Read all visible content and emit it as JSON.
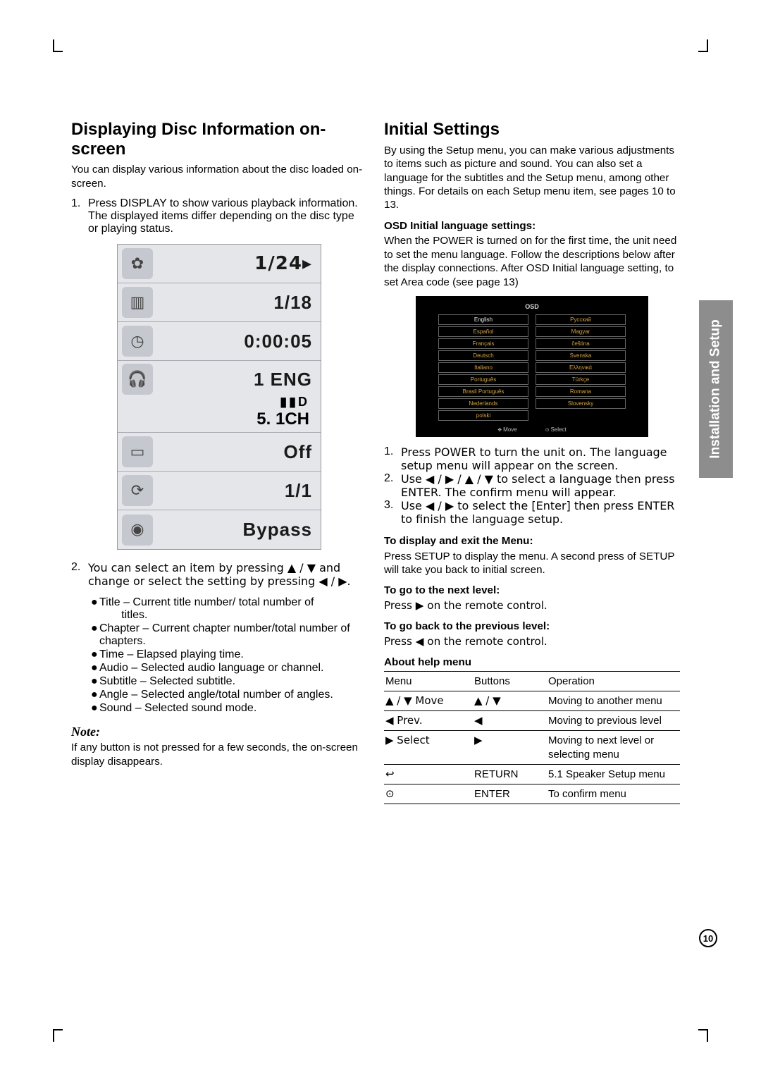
{
  "page_number": "10",
  "side_tab": "Installation and Setup",
  "left": {
    "h": "Displaying Disc Information on-screen",
    "intro": "You can display various information about the disc loaded on-screen.",
    "step1_a": "Press DISPLAY to show various playback information.",
    "step1_b": "The displayed items differ depending on the disc type or playing status.",
    "osd": {
      "title": "1/24",
      "chapter": "1/18",
      "time": "0:00:05",
      "audio_line1": "1 ENG",
      "audio_line2": "D",
      "audio_line3": "5. 1CH",
      "subtitle": "Off",
      "angle": "1/1",
      "sound": "Bypass"
    },
    "step2": "You can select an item by pressing ▲ / ▼ and change or select the setting by pressing ◀ / ▶.",
    "bullets": {
      "b1a": "Title – Current title number/ total number of",
      "b1b": "titles.",
      "b2": "Chapter – Current chapter number/total number of chapters.",
      "b3": "Time – Elapsed playing time.",
      "b4": "Audio – Selected audio language or channel.",
      "b5": "Subtitle – Selected subtitle.",
      "b6": "Angle – Selected angle/total number of angles.",
      "b7": "Sound – Selected sound mode."
    },
    "note_h": "Note:",
    "note_p": "If any button is not pressed for a few seconds, the on-screen display disappears."
  },
  "right": {
    "h": "Initial Settings",
    "intro": "By using the Setup menu, you can make various adjustments to items such as picture and sound. You can also set a language for the subtitles and the Setup menu, among other things. For details on each Setup menu item, see pages 10 to 13.",
    "sub1": "OSD Initial language settings:",
    "sub1_p": "When the POWER is turned on for the first time, the unit need to set the menu language. Follow the descriptions below after the display connections. After OSD Initial language setting, to set Area code (see page 13)",
    "lang_menu": {
      "title": "OSD",
      "left_col": [
        "English",
        "Español",
        "Français",
        "Deutsch",
        "Italiano",
        "Português",
        "Brasil Português",
        "Nederlands",
        "polski"
      ],
      "right_col": [
        "Русский",
        "Magyar",
        "čeština",
        "Svenska",
        "Ελληνικά",
        "Türkçe",
        "Romana",
        "Slovensky"
      ],
      "foot_move": "Move",
      "foot_select": "Select"
    },
    "steps": {
      "s1": "Press POWER to turn the unit on. The language setup menu will appear on the screen.",
      "s2": "Use ◀ / ▶ / ▲ / ▼ to select a language then press ENTER. The confirm menu will appear.",
      "s3": "Use ◀ / ▶ to select the [Enter] then press ENTER to finish the language setup."
    },
    "sub2": "To display and exit the Menu:",
    "sub2_p": "Press SETUP to display the menu. A second press of SETUP will take you back to initial screen.",
    "sub3": "To go to the next level:",
    "sub3_p": "Press ▶ on the remote control.",
    "sub4": "To go back to the previous level:",
    "sub4_p": "Press ◀ on the remote control.",
    "sub5": "About help menu",
    "table": {
      "h1": "Menu",
      "h2": "Buttons",
      "h3": "Operation",
      "r1c1": "▲ / ▼ Move",
      "r1c2": "▲ / ▼",
      "r1c3": "Moving to another menu",
      "r2c1": "◀ Prev.",
      "r2c2": "◀",
      "r2c3": "Moving to previous level",
      "r3c1": "▶ Select",
      "r3c2": "▶",
      "r3c3": "Moving to next level or selecting menu",
      "r4c1": "↩",
      "r4c2": "RETURN",
      "r4c3": "5.1 Speaker Setup menu",
      "r5c1": "⊙",
      "r5c2": "ENTER",
      "r5c3": "To confirm menu"
    }
  }
}
